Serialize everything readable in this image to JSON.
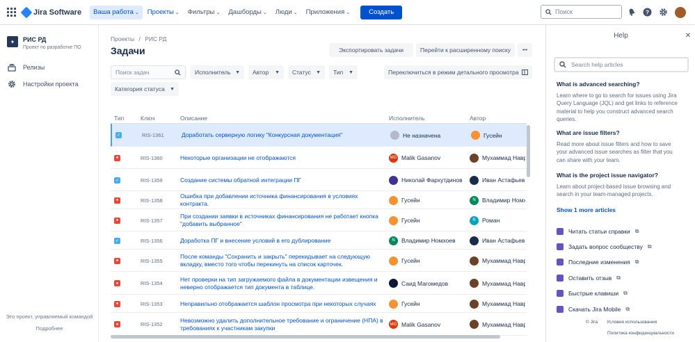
{
  "topbar": {
    "product": "Jira Software",
    "nav": [
      {
        "label": "Ваша работа",
        "selected": true,
        "active": false
      },
      {
        "label": "Проекты",
        "selected": false,
        "active": true
      },
      {
        "label": "Фильтры",
        "selected": false,
        "active": false
      },
      {
        "label": "Дашборды",
        "selected": false,
        "active": false
      },
      {
        "label": "Люди",
        "selected": false,
        "active": false
      },
      {
        "label": "Приложения",
        "selected": false,
        "active": false
      }
    ],
    "create_label": "Создать",
    "search_placeholder": "Поиск"
  },
  "sidebar": {
    "project_name": "РИС РД",
    "project_subtitle": "Проект по разработке ПО",
    "items": [
      {
        "label": "Релизы",
        "icon": "releases-icon"
      },
      {
        "label": "Настройки проекта",
        "icon": "gear-icon"
      }
    ],
    "footer_text": "Это проект, управляемый командой",
    "footer_link": "Подробнее"
  },
  "main": {
    "breadcrumb_root": "Проекты",
    "breadcrumb_sep": "/",
    "breadcrumb_project": "РИС РД",
    "title": "Задачи",
    "export_label": "Экспортировать задачи",
    "advanced_label": "Перейти к расширенному поиску",
    "more_label": "•••",
    "search_placeholder": "Поиск задач",
    "filters": [
      "Исполнитель",
      "Автор",
      "Статус",
      "Тип"
    ],
    "status_category": "Категория статуса",
    "detail_view_label": "Переключиться в режим детального просмотра",
    "columns": {
      "type": "Тип",
      "key": "Ключ",
      "desc": "Описание",
      "assignee": "Исполнитель",
      "author": "Автор"
    },
    "rows": [
      {
        "type": "task",
        "key": "RIS-1361",
        "desc": "Доработать серверную логику \"Конкурсная документация\"",
        "assignee": "Не назначена",
        "assignee_avatar": "#b3bac5",
        "assignee_initials": "",
        "author": "Гусейн",
        "author_avatar": "#f79232",
        "author_initials": "",
        "selected": true
      },
      {
        "type": "bug",
        "key": "RIS-1360",
        "desc": "Некоторые организации не отображаются",
        "assignee": "Malik Gasanov",
        "assignee_avatar": "#de350b",
        "assignee_initials": "MG",
        "author": "Мухаммад Навруз",
        "author_avatar": "#6b4226",
        "author_initials": "",
        "selected": false
      },
      {
        "type": "task",
        "key": "RIS-1359",
        "desc": "Создание системы обратной интеграции ПГ",
        "assignee": "Николай Фархутдинов",
        "assignee_avatar": "#403294",
        "assignee_initials": "",
        "author": "Иван Астафьев",
        "author_avatar": "#172b4d",
        "author_initials": "",
        "selected": false
      },
      {
        "type": "bug",
        "key": "RIS-1358",
        "desc": "Ошибка при добавлении источника финансирования в условиях контракта.",
        "assignee": "Гусейн",
        "assignee_avatar": "#f79232",
        "assignee_initials": "",
        "author": "Владимир Номхоев",
        "author_avatar": "#00875a",
        "author_initials": "N",
        "selected": false
      },
      {
        "type": "bug",
        "key": "RIS-1357",
        "desc": "При создании заявки в источниках финансирования не работает кнопка \"добавить выбранное\"",
        "assignee": "Гусейн",
        "assignee_avatar": "#f79232",
        "assignee_initials": "",
        "author": "Роман",
        "author_avatar": "#00a3bf",
        "author_initials": "R",
        "selected": false
      },
      {
        "type": "task",
        "key": "RIS-1356",
        "desc": "Доработка ПГ и внесение условий в его дублирование",
        "assignee": "Владимир Номхоев",
        "assignee_avatar": "#00875a",
        "assignee_initials": "N",
        "author": "Иван Астафьев",
        "author_avatar": "#172b4d",
        "author_initials": "",
        "selected": false
      },
      {
        "type": "bug",
        "key": "RIS-1355",
        "desc": "После команды \"Сохранить и закрыть\" перекидывает на следующую вкладку, вместо того чтобы перекинуть на список карточек.",
        "assignee": "Гусейн",
        "assignee_avatar": "#f79232",
        "assignee_initials": "",
        "author": "Мухаммад Навруз",
        "author_avatar": "#6b4226",
        "author_initials": "",
        "selected": false
      },
      {
        "type": "bug",
        "key": "RIS-1354",
        "desc": "Нет проверки на тип загружаемого файла в документации извещения и неверно отображается тип документа в таблице.",
        "assignee": "Саид Магомедов",
        "assignee_avatar": "#0b1a3a",
        "assignee_initials": "",
        "author": "Мухаммад Навруз",
        "author_avatar": "#6b4226",
        "author_initials": "",
        "selected": false
      },
      {
        "type": "bug",
        "key": "RIS-1353",
        "desc": "Неправильно отображается шаблон просмотра при некоторых случаях",
        "assignee": "Гусейн",
        "assignee_avatar": "#f79232",
        "assignee_initials": "",
        "author": "Мухаммад Навруз",
        "author_avatar": "#6b4226",
        "author_initials": "",
        "selected": false
      },
      {
        "type": "bug",
        "key": "RIS-1352",
        "desc": "Невозможно удалить дополнительное требование и ограничение (НПА) в требованиях к участникам закупки",
        "assignee": "Malik Gasanov",
        "assignee_avatar": "#de350b",
        "assignee_initials": "MG",
        "author": "Мухаммад Навруз",
        "author_avatar": "#6b4226",
        "author_initials": "",
        "selected": false
      }
    ],
    "colors": {
      "task": "#4bade8",
      "bug": "#e5493a",
      "accent": "#0052cc"
    }
  },
  "help": {
    "title": "Help",
    "search_placeholder": "Search help articles",
    "sections": [
      {
        "heading": "What is advanced searching?",
        "body": "Learn where to go to search for issues using Jira Query Language (JQL) and get links to reference material to help you construct advanced search queries."
      },
      {
        "heading": "What are issue filters?",
        "body": "Read more about issue filters and how to save your advanced issue searches as filter that you can share with your team."
      },
      {
        "heading": "What is the project issue navigator?",
        "body": "Learn about project-based issue browsing and search in your team-managed projects."
      }
    ],
    "more_link": "Show 1 more articles",
    "links": [
      "Читать статьи справки",
      "Задать вопрос сообществу",
      "Последние изменения",
      "Оставить отзыв",
      "Быстрые клавиши",
      "Скачать Jira Mobile"
    ],
    "footer": {
      "copyright": "© Jira",
      "terms": "Условия использования",
      "privacy": "Политика конфиденциальности"
    }
  }
}
